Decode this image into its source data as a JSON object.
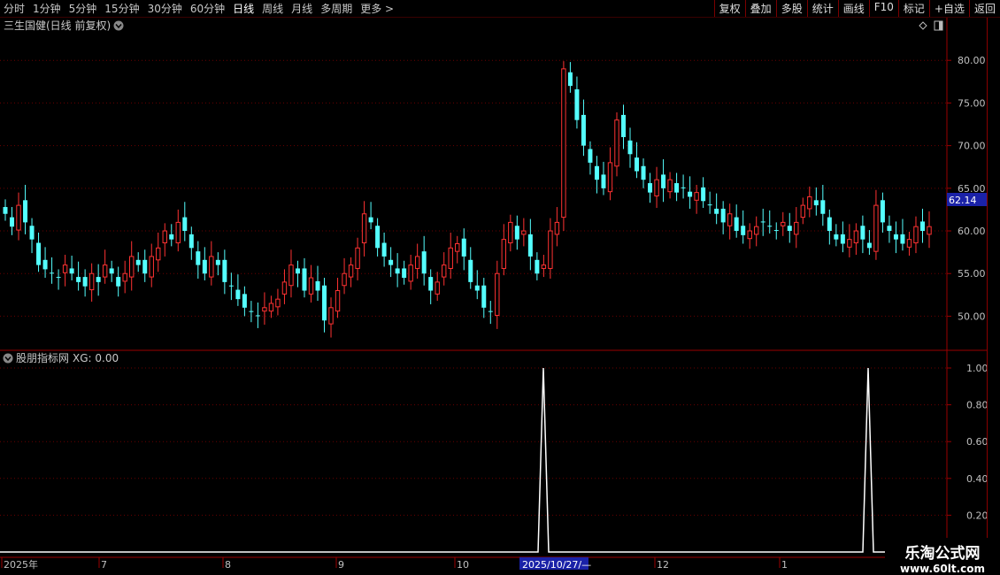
{
  "toolbar": {
    "periods": [
      "分时",
      "1分钟",
      "5分钟",
      "15分钟",
      "30分钟",
      "60分钟",
      "日线",
      "周线",
      "月线",
      "多周期",
      "更多 >"
    ],
    "active_period": "日线",
    "actions": [
      "复权",
      "叠加",
      "多股",
      "统计",
      "画线",
      "F10",
      "标记",
      "+自选",
      "返回"
    ]
  },
  "main_chart": {
    "stock_title": "三生国健(日线 前复权)",
    "price_axis_labels": [
      "80.00",
      "75.00",
      "70.00",
      "65.00",
      "60.00",
      "55.00",
      "50.00"
    ],
    "current_price": "62.14",
    "up_color": "#ff3232",
    "down_color": "#54ffff"
  },
  "indicator_panel": {
    "title": "股朋指标网",
    "readout": "XG: 0.00",
    "axis_labels": [
      "1.00",
      "0.80",
      "0.60",
      "0.40",
      "0.20"
    ],
    "line_color": "#ffffff"
  },
  "time_axis": {
    "labels": [
      "2025年",
      "7",
      "8",
      "9",
      "10",
      "2025/10/27/—",
      "12",
      "1"
    ]
  },
  "watermark": {
    "line1": "乐淘公式网",
    "line2": "www.60lt.com"
  },
  "chart_data": [
    {
      "type": "candlestick",
      "title": "三生国健(日线 前复权)",
      "ylim": [
        46,
        85
      ],
      "y_ticks": [
        50,
        55,
        60,
        65,
        70,
        75,
        80
      ],
      "last_price": 62.14,
      "x_labels": [
        "2025年",
        "7",
        "8",
        "9",
        "10",
        "2025/10/27/—",
        "12",
        "1"
      ],
      "closes": [
        62,
        60.5,
        63,
        61,
        59,
        56,
        55.5,
        55,
        54.5,
        56,
        55,
        54,
        53.5,
        55,
        54,
        56,
        55,
        53.5,
        55,
        57,
        56,
        55,
        57,
        58,
        60,
        59,
        61,
        60,
        58,
        56,
        55,
        57,
        56,
        54,
        53.5,
        52,
        51,
        50.5,
        50,
        51,
        51.5,
        52,
        54,
        56,
        55,
        53,
        54.5,
        53,
        49.5,
        51,
        53,
        55,
        56,
        58,
        62,
        61,
        58,
        57,
        56,
        55,
        54.5,
        56,
        57,
        55,
        53,
        54,
        56,
        58,
        58.5,
        57,
        54,
        53,
        51,
        50.5,
        55,
        59,
        61,
        59,
        60,
        57,
        55,
        56,
        60,
        61,
        79,
        77,
        73,
        70,
        68,
        66,
        65,
        68,
        73,
        71,
        69,
        67,
        66,
        64.5,
        66,
        65,
        66,
        64.5,
        65,
        64,
        64.5,
        63.5,
        63,
        62,
        61,
        62,
        60,
        59.5,
        60,
        60.5,
        61,
        60.5,
        60,
        61,
        60,
        61,
        63,
        64,
        63,
        62,
        60,
        59,
        58.5,
        59,
        60,
        59,
        58,
        63,
        61,
        60,
        59,
        58.5,
        59,
        60.5,
        60,
        60.5
      ],
      "signal_XG": {
        "values": [
          0,
          1,
          0,
          1,
          0
        ],
        "note_positions": [
          "2025/10/27/—",
          "last"
        ]
      }
    }
  ]
}
